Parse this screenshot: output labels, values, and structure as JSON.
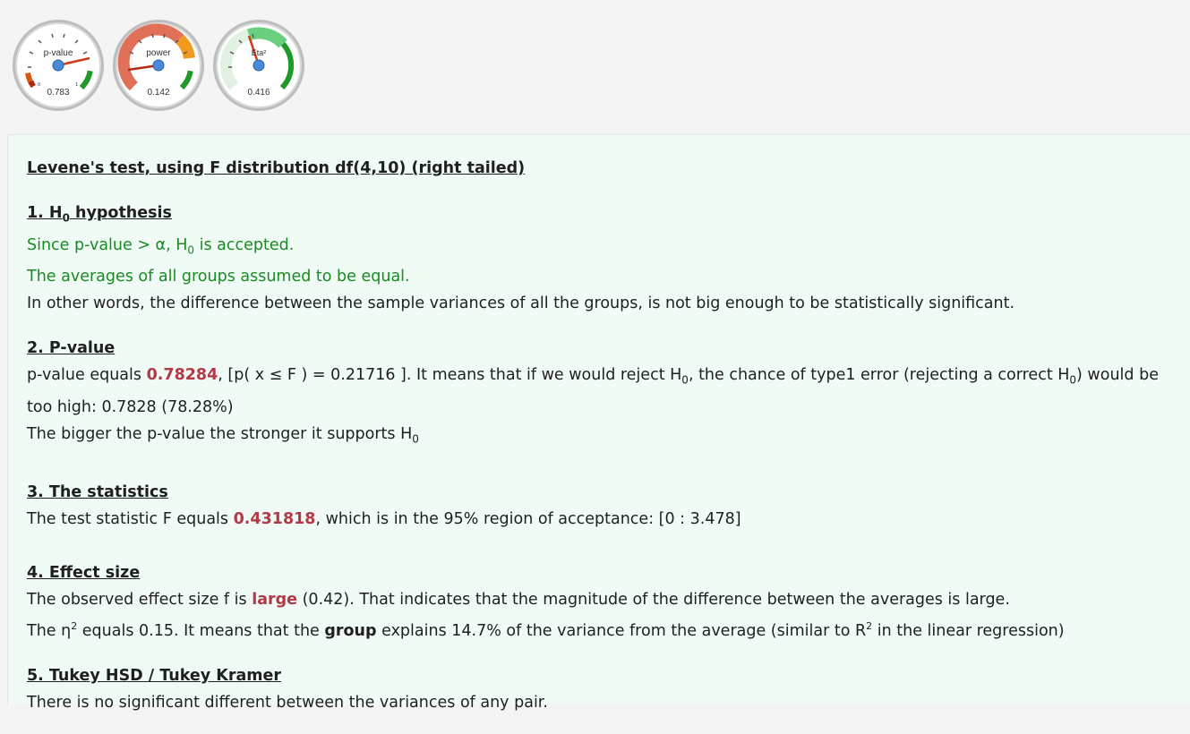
{
  "gauges": [
    {
      "label": "p-value",
      "value_text": "0.783",
      "value": 0.783
    },
    {
      "label": "power",
      "value_text": "0.142",
      "value": 0.142
    },
    {
      "label": "Eta²",
      "value_text": "0.416",
      "value": 0.416
    }
  ],
  "gauge_scale": {
    "min": "0",
    "max": "1"
  },
  "report": {
    "title": "Levene's test, using F distribution df(4,10) (right tailed)",
    "s1": {
      "heading_pre": "1. H",
      "heading_sub": "0",
      "heading_post": " hypothesis",
      "l1a": "Since p-value > α, H",
      "l1sub": "0",
      "l1b": " is accepted.",
      "l2": "The averages of all groups assumed to be equal.",
      "l3": "In other words, the difference between the sample variances of all the groups, is not big enough to be statistically significant."
    },
    "s2": {
      "heading": "2. P-value",
      "p1": "p-value equals ",
      "p_value": "0.78284",
      "p2": ", [p( x ≤ F ) = 0.21716 ]. It means that if we would reject H",
      "sub1": "0",
      "p3": ", the chance of type1 error (rejecting a correct H",
      "sub2": "0",
      "p4": ") would be too high: 0.7828 (78.28%)",
      "l2a": "The bigger the p-value the stronger it supports H",
      "l2sub": "0"
    },
    "s3": {
      "heading": "3. The statistics",
      "a": "The test statistic F equals ",
      "f_value": "0.431818",
      "b": ", which is in the 95% region of acceptance: [0 : 3.478]"
    },
    "s4": {
      "heading": "4. Effect size",
      "l1a": "The observed effect size f is ",
      "size_word": "large",
      "l1b": " (0.42). That indicates that the magnitude of the difference between the averages is large.",
      "l2a": "The η",
      "l2sup1": "2",
      "l2b": " equals 0.15. It means that the ",
      "l2bold": "group",
      "l2c": " explains 14.7% of the variance from the average (similar to R",
      "l2sup2": "2",
      "l2d": " in the linear regression)"
    },
    "s5": {
      "heading": "5. Tukey HSD / Tukey Kramer",
      "l1": "There is no significant different between the variances of any pair."
    }
  },
  "colors": {
    "green_text": "#1a8a24",
    "highlight": "#b23a48",
    "panel_bg": "#f0fbf6"
  }
}
